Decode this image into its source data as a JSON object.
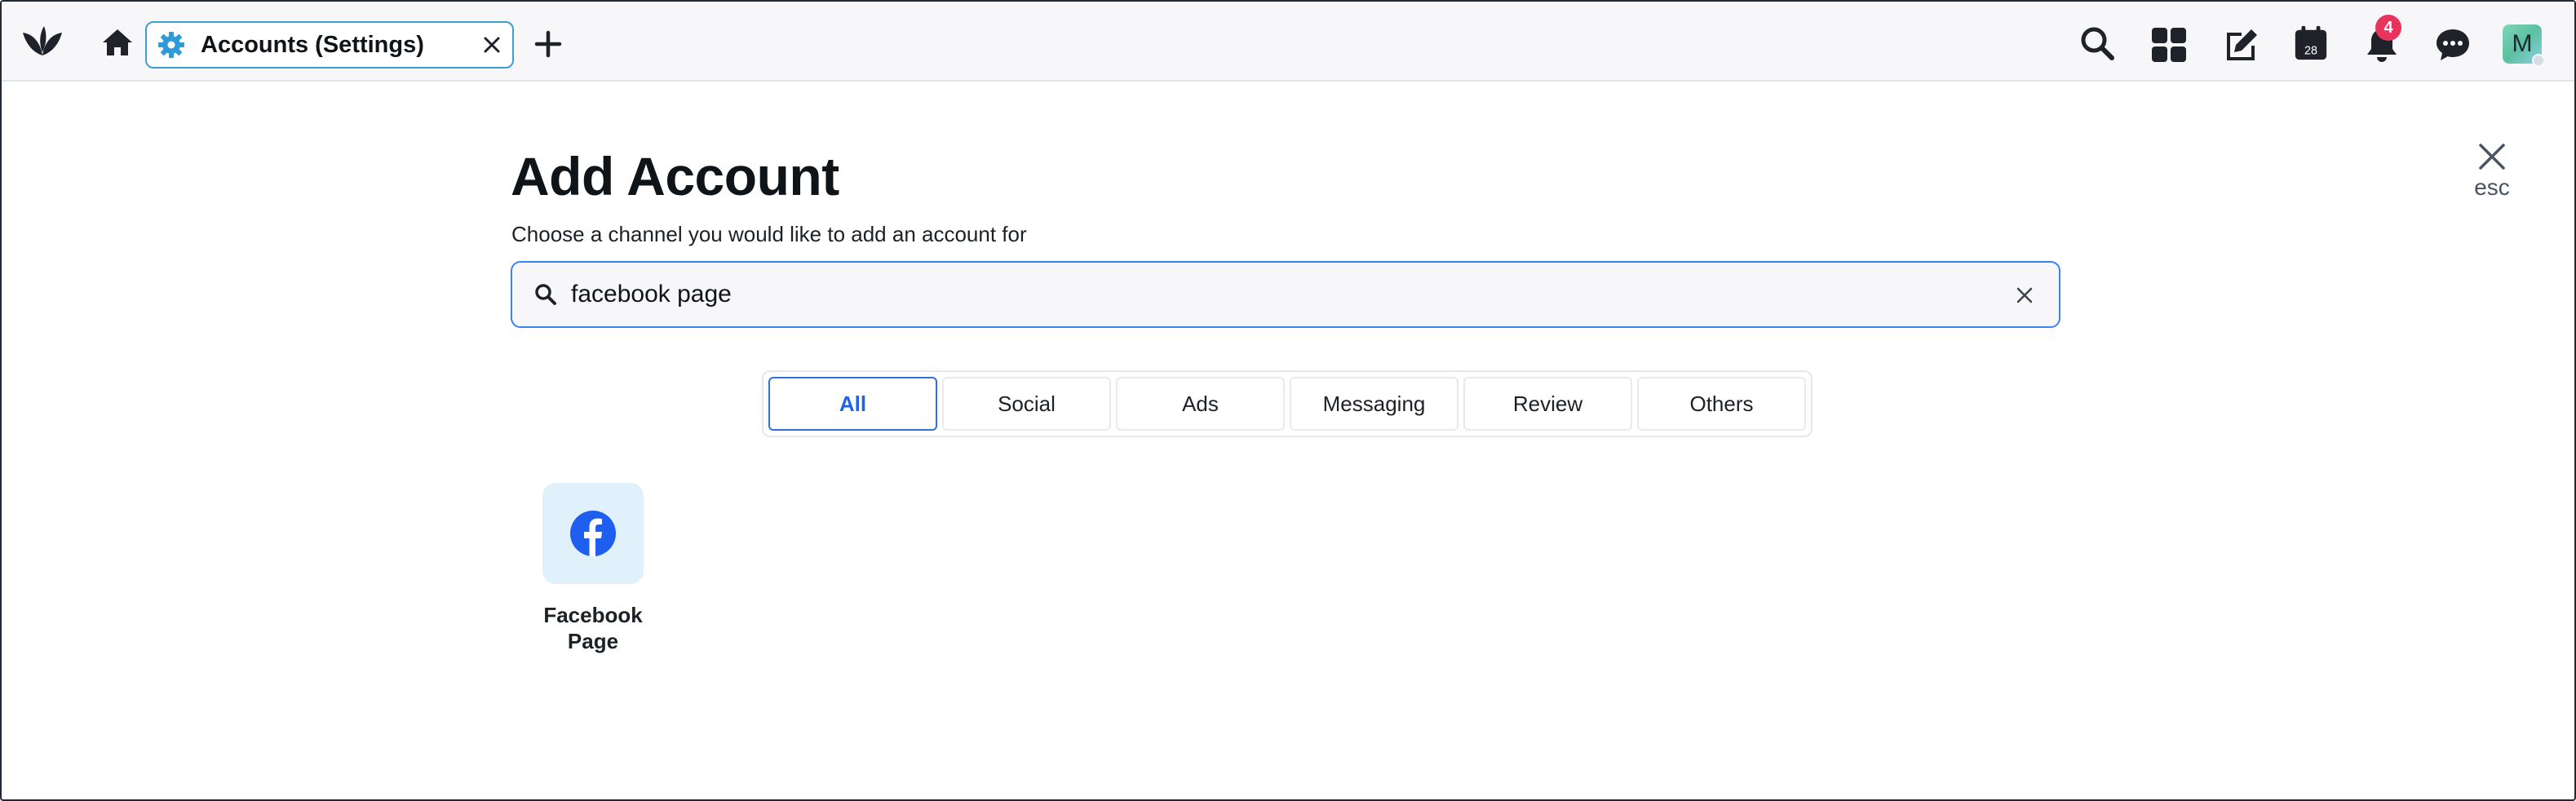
{
  "topbar": {
    "tab_label": "Accounts (Settings)",
    "notification_count": "4",
    "calendar_day": "28",
    "avatar_initial": "M"
  },
  "icons": {
    "logo": "sprout-logo-icon",
    "home": "home-icon",
    "tab": "gear-icon",
    "close_tab": "close-icon",
    "new_tab": "plus-icon",
    "search": "search-icon",
    "apps": "grid-icon",
    "compose": "compose-icon",
    "calendar": "calendar-icon",
    "notifications": "bell-icon",
    "messages": "chat-icon"
  },
  "modal": {
    "title": "Add Account",
    "subtitle": "Choose a channel you would like to add an account for",
    "close_hint": "esc"
  },
  "search": {
    "value": "facebook page",
    "placeholder": ""
  },
  "filters": [
    {
      "label": "All",
      "active": true
    },
    {
      "label": "Social",
      "active": false
    },
    {
      "label": "Ads",
      "active": false
    },
    {
      "label": "Messaging",
      "active": false
    },
    {
      "label": "Review",
      "active": false
    },
    {
      "label": "Others",
      "active": false
    }
  ],
  "results": [
    {
      "label": "Facebook Page",
      "icon": "facebook-icon"
    }
  ],
  "colors": {
    "accent": "#3b82f6",
    "badge": "#e8345c",
    "facebook": "#1877f2",
    "tab_border": "#3a9fd6"
  }
}
